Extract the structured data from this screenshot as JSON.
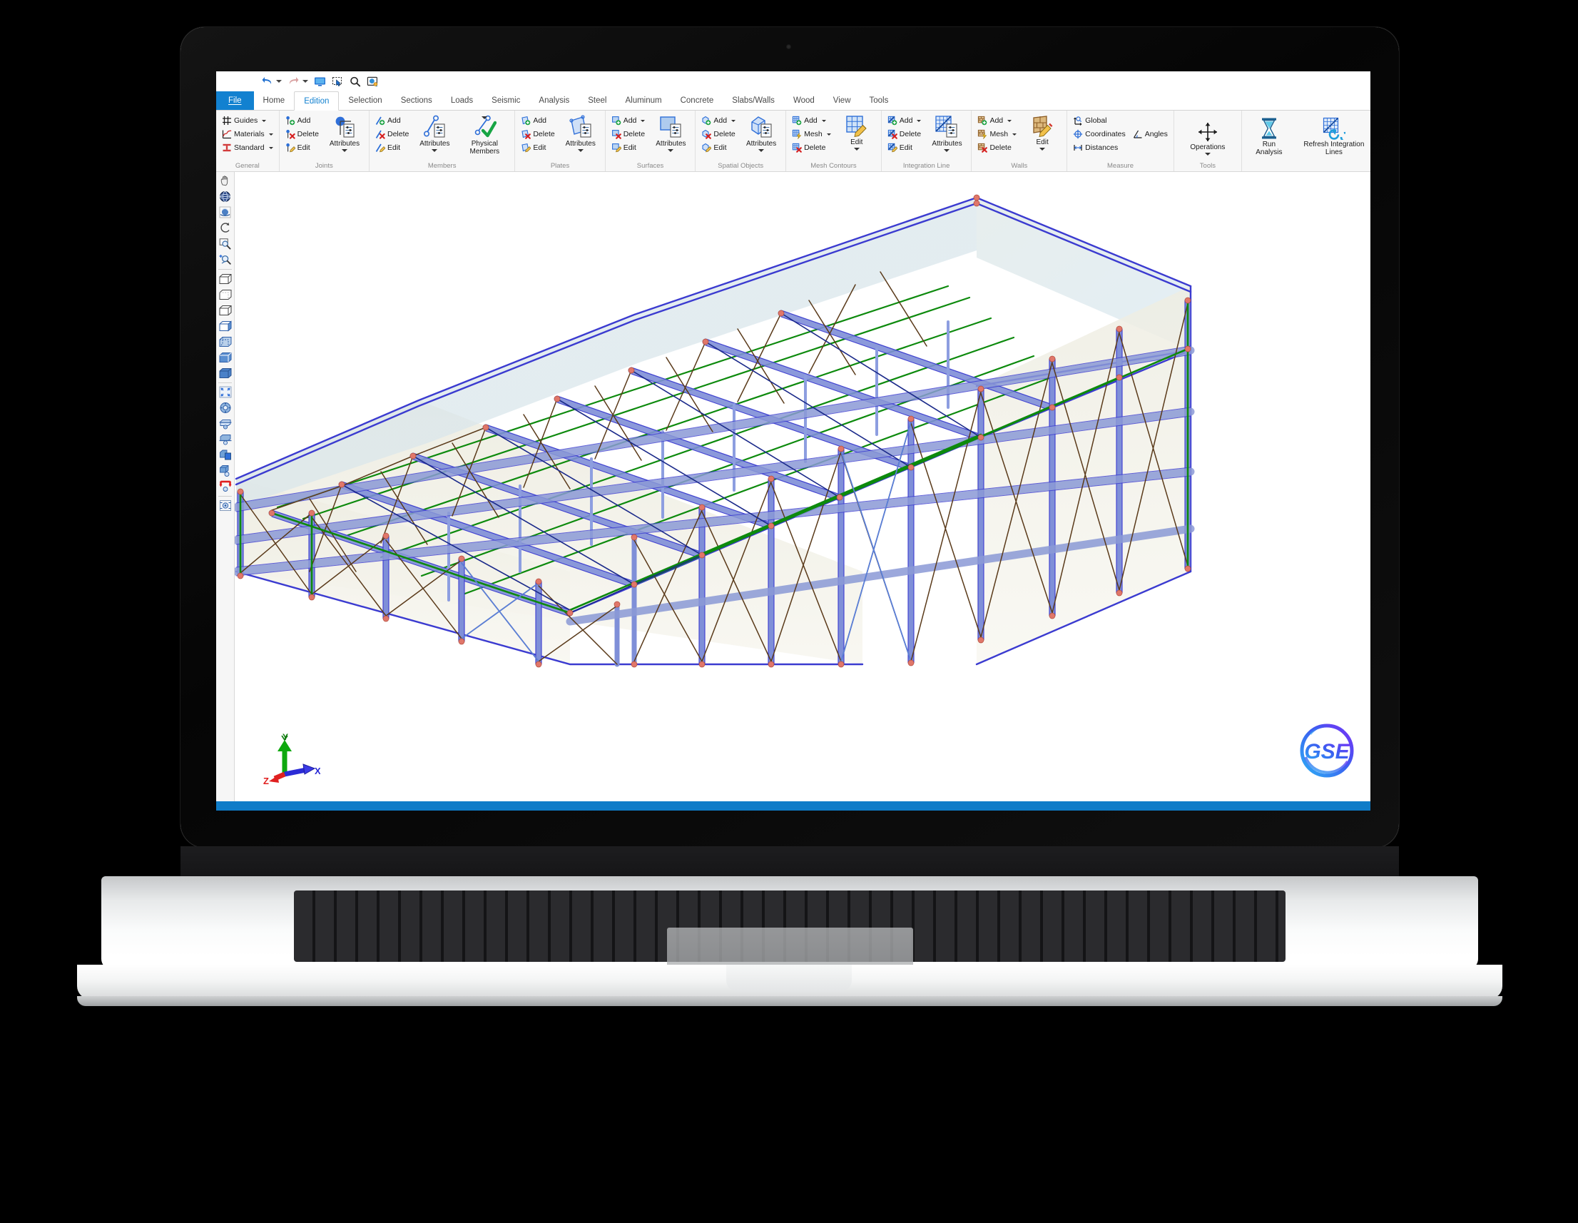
{
  "app": {
    "status_bar_color": "#0f7cc8",
    "accent_color": "#1281d0"
  },
  "quick_access": {
    "items": [
      {
        "name": "undo",
        "label": "Undo",
        "icon": "undo-icon",
        "has_dropdown": true
      },
      {
        "name": "redo",
        "label": "Redo",
        "icon": "redo-icon",
        "has_dropdown": true
      },
      {
        "name": "display",
        "label": "Display",
        "icon": "monitor-icon",
        "has_dropdown": false
      },
      {
        "name": "select-window",
        "label": "Select Window",
        "icon": "marquee-select-icon",
        "has_dropdown": false
      },
      {
        "name": "zoom",
        "label": "Zoom",
        "icon": "magnifier-icon",
        "has_dropdown": false
      },
      {
        "name": "snapshot",
        "label": "Snapshot",
        "icon": "snapshot-icon",
        "has_dropdown": false
      }
    ]
  },
  "tabs": [
    {
      "label": "File",
      "type": "file",
      "active": false
    },
    {
      "label": "Home",
      "type": "normal",
      "active": false
    },
    {
      "label": "Edition",
      "type": "normal",
      "active": true
    },
    {
      "label": "Selection",
      "type": "normal",
      "active": false
    },
    {
      "label": "Sections",
      "type": "normal",
      "active": false
    },
    {
      "label": "Loads",
      "type": "normal",
      "active": false
    },
    {
      "label": "Seismic",
      "type": "normal",
      "active": false
    },
    {
      "label": "Analysis",
      "type": "normal",
      "active": false
    },
    {
      "label": "Steel",
      "type": "normal",
      "active": false
    },
    {
      "label": "Aluminum",
      "type": "normal",
      "active": false
    },
    {
      "label": "Concrete",
      "type": "normal",
      "active": false
    },
    {
      "label": "Slabs/Walls",
      "type": "normal",
      "active": false
    },
    {
      "label": "Wood",
      "type": "normal",
      "active": false
    },
    {
      "label": "View",
      "type": "normal",
      "active": false
    },
    {
      "label": "Tools",
      "type": "normal",
      "active": false
    }
  ],
  "ribbon": {
    "groups": [
      {
        "name": "general",
        "label": "General",
        "small_items": [
          {
            "label": "Guides",
            "icon": "grid-guides-icon",
            "dropdown": true
          },
          {
            "label": "Materials",
            "icon": "materials-curve-icon",
            "dropdown": true
          },
          {
            "label": "Standard",
            "icon": "i-beam-icon",
            "dropdown": true
          }
        ],
        "big_items": []
      },
      {
        "name": "joints",
        "label": "Joints",
        "small_items": [
          {
            "label": "Add",
            "icon": "joint-add-icon",
            "dropdown": false
          },
          {
            "label": "Delete",
            "icon": "joint-delete-icon",
            "dropdown": false
          },
          {
            "label": "Edit",
            "icon": "joint-edit-icon",
            "dropdown": false
          }
        ],
        "big_items": [
          {
            "label": "Attributes",
            "icon": "joint-attributes-icon",
            "dropdown": true
          }
        ]
      },
      {
        "name": "members",
        "label": "Members",
        "small_items": [
          {
            "label": "Add",
            "icon": "member-add-icon",
            "dropdown": false
          },
          {
            "label": "Delete",
            "icon": "member-delete-icon",
            "dropdown": false
          },
          {
            "label": "Edit",
            "icon": "member-edit-icon",
            "dropdown": false
          }
        ],
        "big_items": [
          {
            "label": "Attributes",
            "icon": "member-attributes-icon",
            "dropdown": true
          },
          {
            "label": "Physical Members",
            "icon": "physical-members-icon",
            "dropdown": true
          }
        ]
      },
      {
        "name": "plates",
        "label": "Plates",
        "small_items": [
          {
            "label": "Add",
            "icon": "plate-add-icon",
            "dropdown": false
          },
          {
            "label": "Delete",
            "icon": "plate-delete-icon",
            "dropdown": false
          },
          {
            "label": "Edit",
            "icon": "plate-edit-icon",
            "dropdown": false
          }
        ],
        "big_items": [
          {
            "label": "Attributes",
            "icon": "plate-attributes-icon",
            "dropdown": true
          }
        ]
      },
      {
        "name": "surfaces",
        "label": "Surfaces",
        "small_items": [
          {
            "label": "Add",
            "icon": "surface-add-icon",
            "dropdown": true
          },
          {
            "label": "Delete",
            "icon": "surface-delete-icon",
            "dropdown": false
          },
          {
            "label": "Edit",
            "icon": "surface-edit-icon",
            "dropdown": false
          }
        ],
        "big_items": [
          {
            "label": "Attributes",
            "icon": "surface-attributes-icon",
            "dropdown": true
          }
        ]
      },
      {
        "name": "spatial-objects",
        "label": "Spatial Objects",
        "small_items": [
          {
            "label": "Add",
            "icon": "spatial-add-icon",
            "dropdown": true
          },
          {
            "label": "Delete",
            "icon": "spatial-delete-icon",
            "dropdown": false
          },
          {
            "label": "Edit",
            "icon": "spatial-edit-icon",
            "dropdown": false
          }
        ],
        "big_items": [
          {
            "label": "Attributes",
            "icon": "spatial-attributes-icon",
            "dropdown": true
          }
        ]
      },
      {
        "name": "mesh-contours",
        "label": "Mesh Contours",
        "small_items": [
          {
            "label": "Add",
            "icon": "mesh-add-icon",
            "dropdown": true
          },
          {
            "label": "Mesh",
            "icon": "mesh-generate-icon",
            "dropdown": true
          },
          {
            "label": "Delete",
            "icon": "mesh-delete-icon",
            "dropdown": false
          }
        ],
        "big_items": [
          {
            "label": "Edit",
            "icon": "mesh-edit-icon",
            "dropdown": true
          }
        ]
      },
      {
        "name": "integration-line",
        "label": "Integration Line",
        "small_items": [
          {
            "label": "Add",
            "icon": "intline-add-icon",
            "dropdown": true
          },
          {
            "label": "Delete",
            "icon": "intline-delete-icon",
            "dropdown": false
          },
          {
            "label": "Edit",
            "icon": "intline-edit-icon",
            "dropdown": false
          }
        ],
        "big_items": [
          {
            "label": "Attributes",
            "icon": "intline-attributes-icon",
            "dropdown": true
          }
        ]
      },
      {
        "name": "walls",
        "label": "Walls",
        "small_items": [
          {
            "label": "Add",
            "icon": "wall-add-icon",
            "dropdown": true
          },
          {
            "label": "Mesh",
            "icon": "wall-mesh-icon",
            "dropdown": true
          },
          {
            "label": "Delete",
            "icon": "wall-delete-icon",
            "dropdown": false
          }
        ],
        "big_items": [
          {
            "label": "Edit",
            "icon": "wall-edit-icon",
            "dropdown": true
          }
        ]
      },
      {
        "name": "measure",
        "label": "Measure",
        "small_items": [
          {
            "label": "Global",
            "icon": "global-axes-icon",
            "dropdown": true
          },
          {
            "label": "Coordinates",
            "icon": "coordinates-icon",
            "dropdown": false
          },
          {
            "label": "Angles",
            "icon": "angles-icon",
            "dropdown": false
          },
          {
            "label": "Distances",
            "icon": "distances-icon",
            "dropdown": false
          }
        ],
        "big_items": []
      },
      {
        "name": "tools",
        "label": "Tools",
        "small_items": [],
        "big_items": [
          {
            "label": "Operations",
            "icon": "move-arrows-icon",
            "dropdown": true
          }
        ]
      },
      {
        "name": "analysis-actions",
        "label": "",
        "small_items": [],
        "big_items": [
          {
            "label": "Run Analysis",
            "icon": "hourglass-icon",
            "dropdown": false
          },
          {
            "label": "Refresh Integration Lines",
            "icon": "refresh-mesh-icon",
            "dropdown": false
          }
        ]
      }
    ]
  },
  "left_toolbar": {
    "items": [
      {
        "name": "pan-tool",
        "icon": "hand-icon"
      },
      {
        "name": "orbit-globe-tool",
        "icon": "globe-icon"
      },
      {
        "name": "rotate-view-tool",
        "icon": "rotate-sphere-icon"
      },
      {
        "name": "undo-view-tool",
        "icon": "curved-arrow-icon"
      },
      {
        "name": "zoom-window-tool",
        "icon": "zoom-box-icon"
      },
      {
        "name": "zoom-in-tool",
        "icon": "zoom-plus-icon"
      },
      {
        "name": "view-wireframe-1",
        "icon": "cube-wireframe-icon"
      },
      {
        "name": "view-wireframe-2",
        "icon": "cube-hidden-line-icon"
      },
      {
        "name": "view-wireframe-3",
        "icon": "cube-outline-icon"
      },
      {
        "name": "view-shaded-1",
        "icon": "cube-half-shaded-icon"
      },
      {
        "name": "view-shaded-2",
        "icon": "cube-dashed-shaded-icon"
      },
      {
        "name": "view-shaded-3",
        "icon": "cube-shaded-icon"
      },
      {
        "name": "view-solid",
        "icon": "cube-solid-icon"
      },
      {
        "name": "zoom-extents",
        "icon": "fit-arrows-icon"
      },
      {
        "name": "view-rotate-settings",
        "icon": "rotate-gear-icon"
      },
      {
        "name": "clip-plane-top",
        "icon": "clip-top-icon"
      },
      {
        "name": "clip-plane-bottom",
        "icon": "clip-bottom-icon"
      },
      {
        "name": "section-view",
        "icon": "section-cube-icon"
      },
      {
        "name": "section-view-settings",
        "icon": "section-cube-gear-icon"
      },
      {
        "name": "supports-display",
        "icon": "supports-red-icon"
      },
      {
        "name": "camera-target",
        "icon": "camera-target-icon"
      }
    ]
  },
  "viewport": {
    "axis_triad": {
      "x_label": "X",
      "y_label": "Y",
      "z_label": "Z",
      "x_color": "#2b2bd6",
      "y_color": "#0ea80e",
      "z_color": "#e02020"
    },
    "logo": {
      "text": "GSE",
      "gradient_from": "#2db0f5",
      "gradient_to": "#7b2ff7"
    },
    "model": {
      "description": "3D structural steel frame building model",
      "member_color": "#3b3bd0",
      "brace_color": "#5a3a1a",
      "purlin_color": "#0d8a0d",
      "node_color": "#e07a6a",
      "wall_fill": "#f4f2e8",
      "roof_fill": "#e2eaea"
    }
  }
}
